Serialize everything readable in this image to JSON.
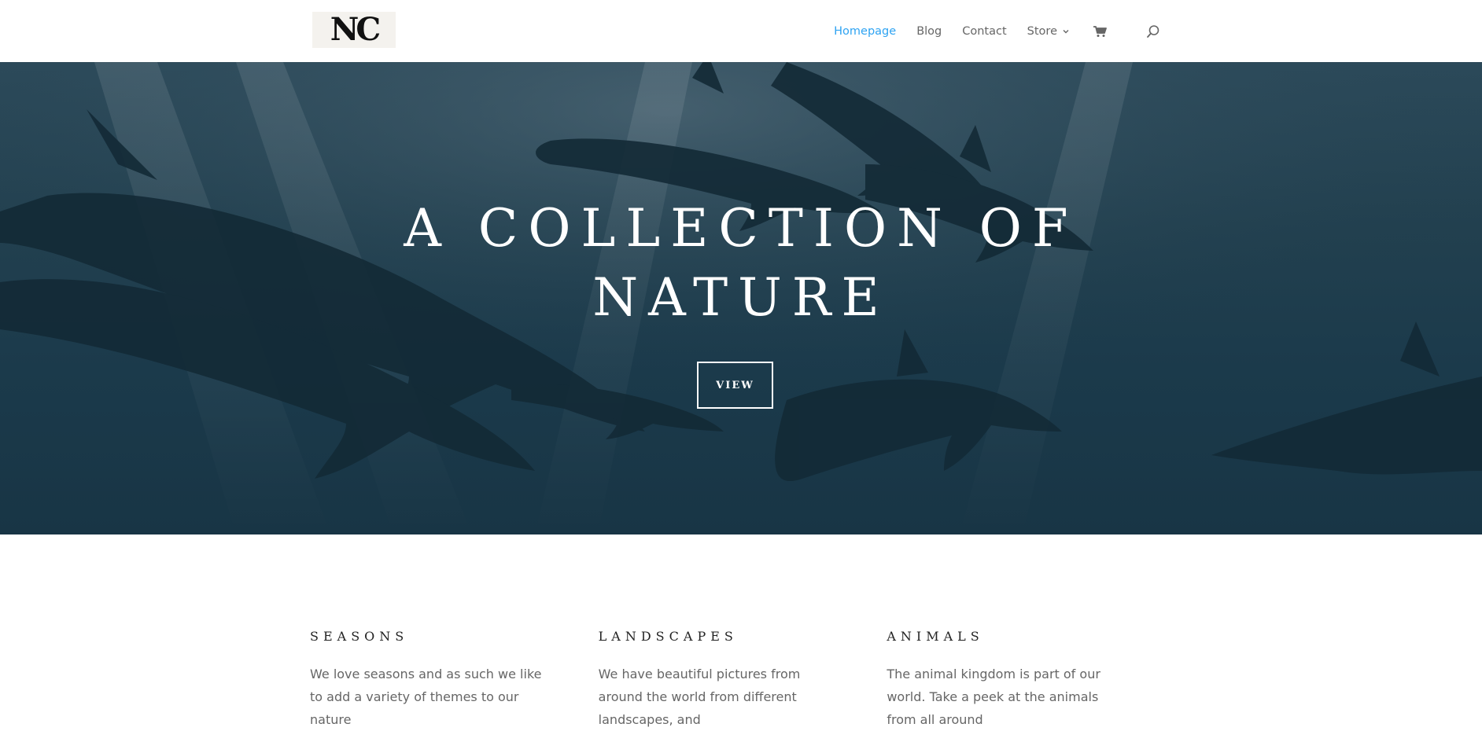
{
  "logo": {
    "text": "NC"
  },
  "nav": {
    "items": [
      {
        "label": "Homepage",
        "active": true
      },
      {
        "label": "Blog",
        "active": false
      },
      {
        "label": "Contact",
        "active": false
      },
      {
        "label": "Store",
        "active": false,
        "dropdown": true
      }
    ],
    "icons": [
      "cart-icon",
      "search-icon"
    ],
    "active_color": "#2ea3f2",
    "text_color": "#666666"
  },
  "hero": {
    "title_line1": "A COLLECTION OF",
    "title_line2": "NATURE",
    "button_label": "VIEW",
    "overlay_color": "#1b3a4b"
  },
  "columns": [
    {
      "title": "SEASONS",
      "text": "We love seasons and as such we like to add a variety of themes to our nature"
    },
    {
      "title": "LANDSCAPES",
      "text": "We have beautiful pictures from around the world from different landscapes, and"
    },
    {
      "title": "ANIMALS",
      "text": "The animal kingdom is part of our world. Take a peek at the animals from all around"
    }
  ]
}
